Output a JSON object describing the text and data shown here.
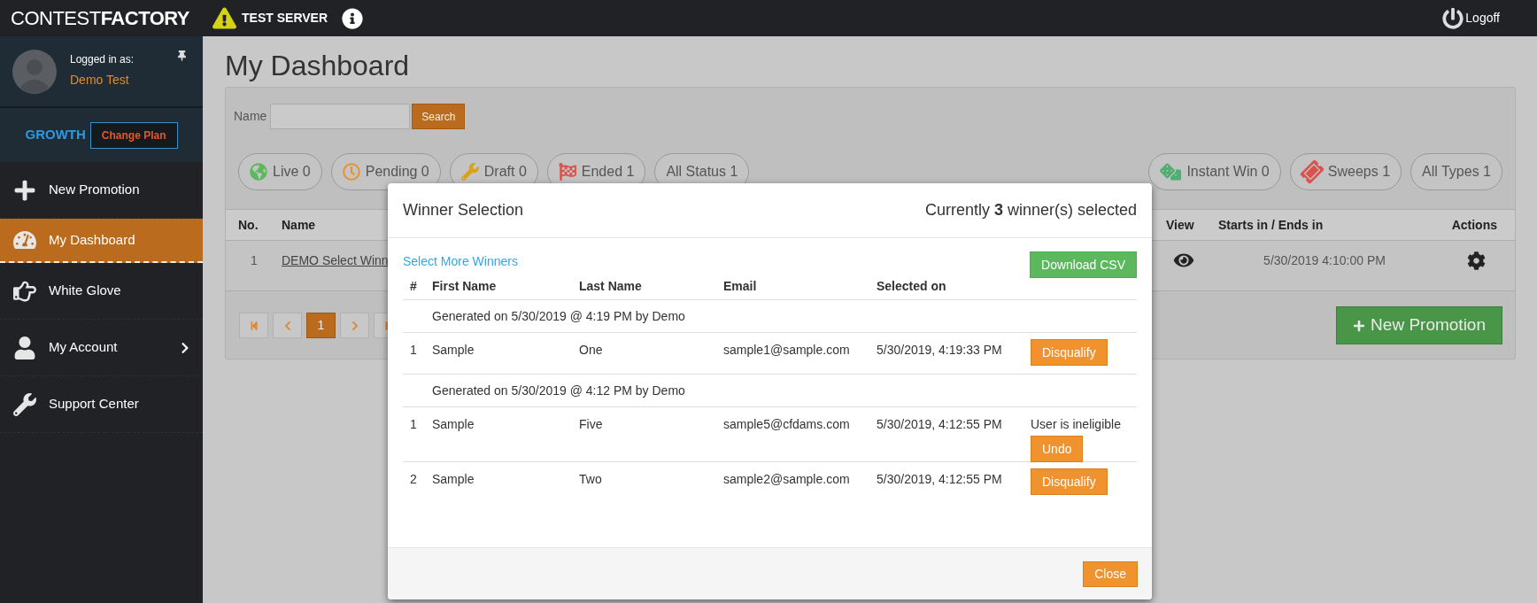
{
  "header": {
    "logo_light": "CONTEST",
    "logo_bold": "FACTORY",
    "server_label": "TEST SERVER",
    "logoff": "Logoff"
  },
  "sidebar": {
    "logged_in_label": "Logged in as:",
    "user_name": "Demo Test",
    "plan": "GROWTH",
    "change_plan": "Change Plan",
    "items": [
      {
        "label": "New Promotion",
        "kind": "plus",
        "selected": false,
        "has_submenu": false
      },
      {
        "label": "My Dashboard",
        "kind": "gauge",
        "selected": true,
        "has_submenu": false
      },
      {
        "label": "White Glove",
        "kind": "hand",
        "selected": false,
        "has_submenu": false
      },
      {
        "label": "My Account",
        "kind": "user",
        "selected": false,
        "has_submenu": true
      },
      {
        "label": "Support Center",
        "kind": "wrench",
        "selected": false,
        "has_submenu": false
      }
    ]
  },
  "page": {
    "title": "My Dashboard",
    "search": {
      "label": "Name",
      "button": "Search"
    },
    "status_filters": [
      {
        "label": "Live 0",
        "kind": "globe"
      },
      {
        "label": "Pending 0",
        "kind": "clock"
      },
      {
        "label": "Draft 0",
        "kind": "wrench"
      },
      {
        "label": "Ended 1",
        "kind": "flag"
      },
      {
        "label": "All Status 1"
      }
    ],
    "type_filters": [
      {
        "label": "Instant Win 0",
        "kind": "dice"
      },
      {
        "label": "Sweeps 1",
        "kind": "ticket"
      },
      {
        "label": "All Types 1"
      }
    ],
    "table": {
      "columns": [
        "No.",
        "Name",
        "View",
        "Starts in / Ends in",
        "Actions"
      ],
      "rows": [
        {
          "no": "1",
          "name": "DEMO Select Winn",
          "starts_ends": "5/30/2019 4:10:00 PM"
        }
      ]
    },
    "pagination": {
      "pages": [
        {
          "label": "1",
          "selected": true
        }
      ]
    },
    "new_promotion": "New Promotion"
  },
  "modal": {
    "title": "Winner Selection",
    "summary": "Currently **3** winner(s) selected",
    "select_more": "Select More Winners",
    "download": "Download CSV",
    "columns": [
      "#",
      "First Name",
      "Last Name",
      "Email",
      "Selected on"
    ],
    "groups": [
      {
        "caption": "Generated on 5/30/2019 @ 4:19 PM by Demo",
        "winners": [
          {
            "no": "1",
            "first": "Sample",
            "last": "One",
            "email": "sample1@sample.com",
            "selected_on": "5/30/2019, 4:19:33 PM",
            "disqualified": false,
            "action": "Disqualify"
          }
        ]
      },
      {
        "caption": "Generated on 5/30/2019 @ 4:12 PM by Demo",
        "winners": [
          {
            "no": "1",
            "first": "Sample",
            "last": "Five",
            "email": "sample5@cfdams.com",
            "selected_on": "5/30/2019, 4:12:55 PM",
            "disqualified": true,
            "status": "User is ineligible",
            "action": "Undo"
          },
          {
            "no": "2",
            "first": "Sample",
            "last": "Two",
            "email": "sample2@sample.com",
            "selected_on": "5/30/2019, 4:12:55 PM",
            "disqualified": false,
            "action": "Disqualify"
          }
        ]
      }
    ],
    "close": "Close"
  }
}
